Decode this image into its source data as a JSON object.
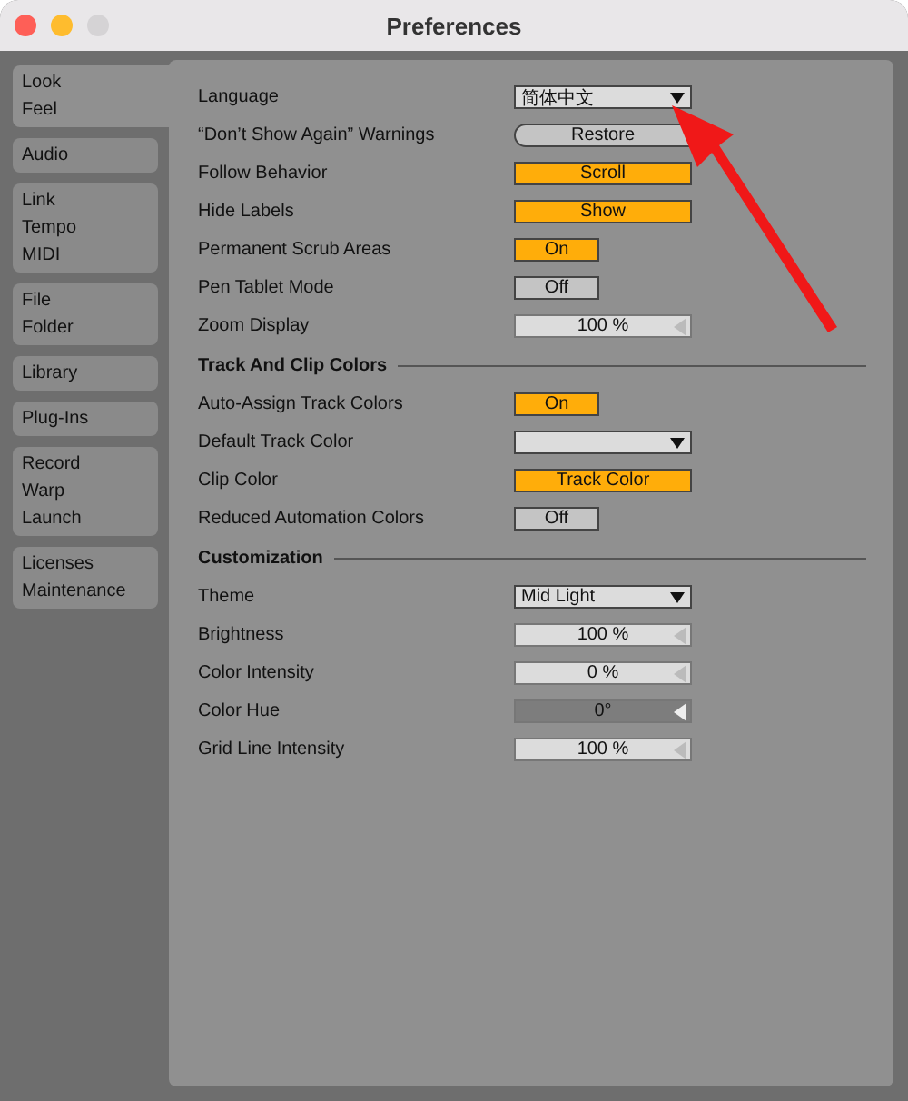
{
  "window": {
    "title": "Preferences"
  },
  "sidebar": {
    "items": [
      {
        "lines": [
          "Look",
          "Feel"
        ],
        "selected": true
      },
      {
        "lines": [
          "Audio"
        ],
        "selected": false
      },
      {
        "lines": [
          "Link",
          "Tempo",
          "MIDI"
        ],
        "selected": false
      },
      {
        "lines": [
          "File",
          "Folder"
        ],
        "selected": false
      },
      {
        "lines": [
          "Library"
        ],
        "selected": false
      },
      {
        "lines": [
          "Plug-Ins"
        ],
        "selected": false
      },
      {
        "lines": [
          "Record",
          "Warp",
          "Launch"
        ],
        "selected": false
      },
      {
        "lines": [
          "Licenses",
          "Maintenance"
        ],
        "selected": false
      }
    ]
  },
  "sections": [
    {
      "rows": [
        {
          "label": "Language",
          "kind": "dropdown",
          "value": "简体中文"
        },
        {
          "label": "“Don’t Show Again” Warnings",
          "kind": "action",
          "value": "Restore"
        },
        {
          "label": "Follow Behavior",
          "kind": "choice",
          "value": "Scroll",
          "on": true
        },
        {
          "label": "Hide Labels",
          "kind": "choice",
          "value": "Show",
          "on": true
        },
        {
          "label": "Permanent Scrub Areas",
          "kind": "toggle",
          "value": "On",
          "on": true
        },
        {
          "label": "Pen Tablet Mode",
          "kind": "toggle",
          "value": "Off",
          "on": false
        },
        {
          "label": "Zoom Display",
          "kind": "number",
          "value": "100 %",
          "disabled": false
        }
      ]
    },
    {
      "title": "Track And Clip Colors",
      "rows": [
        {
          "label": "Auto-Assign Track Colors",
          "kind": "toggle",
          "value": "On",
          "on": true
        },
        {
          "label": "Default Track Color",
          "kind": "dropdown"
        },
        {
          "label": "Clip Color",
          "kind": "choice",
          "value": "Track Color",
          "on": true
        },
        {
          "label": "Reduced Automation Colors",
          "kind": "toggle",
          "value": "Off",
          "on": false
        }
      ]
    },
    {
      "title": "Customization",
      "rows": [
        {
          "label": "Theme",
          "kind": "dropdown",
          "value": "Mid Light"
        },
        {
          "label": "Brightness",
          "kind": "number",
          "value": "100 %",
          "disabled": false
        },
        {
          "label": "Color Intensity",
          "kind": "number",
          "value": "0 %",
          "disabled": false
        },
        {
          "label": "Color Hue",
          "kind": "number",
          "value": "0°",
          "disabled": true
        },
        {
          "label": "Grid Line Intensity",
          "kind": "number",
          "value": "100 %",
          "disabled": false
        }
      ]
    }
  ]
}
